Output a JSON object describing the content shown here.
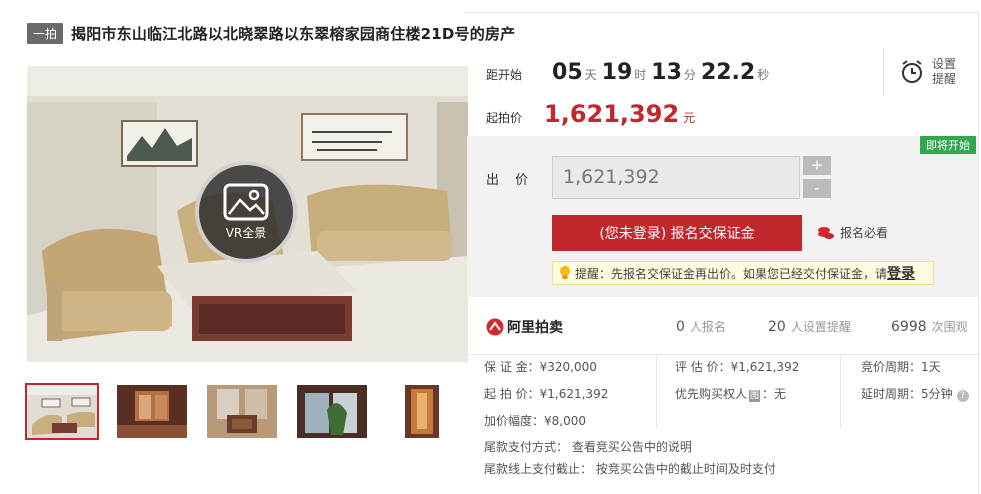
{
  "header": {
    "tag": "一拍",
    "title": "揭阳市东山临江北路以北晓翠路以东翠榕家园商住楼21D号的房产"
  },
  "countdown": {
    "label": "距开始",
    "days": "05",
    "days_unit": "天",
    "hours": "19",
    "hours_unit": "时",
    "minutes": "13",
    "minutes_unit": "分",
    "seconds": "22.2",
    "seconds_unit": "秒"
  },
  "reminder": {
    "label": "设置提醒",
    "icon": "alarm-clock-icon"
  },
  "start_price": {
    "label": "起拍价",
    "value": "1,621,392",
    "unit": "元"
  },
  "bid": {
    "badge": "即将开始",
    "label": "出 价",
    "value": "1,621,392",
    "plus": "+",
    "minus": "-",
    "register_button": "(您未登录) 报名交保证金",
    "must_read": "报名必看",
    "tip_text": "提醒：先报名交保证金再出价。如果您已经交付保证金，请",
    "tip_login": "登录"
  },
  "stats": {
    "brand": "阿里拍卖",
    "signups_count": "0",
    "signups_label": "人报名",
    "reminders_count": "20",
    "reminders_label": "人设置提醒",
    "views_count": "6998",
    "views_label": "次围观"
  },
  "details": {
    "deposit": "保 证 金：¥320,000",
    "start": "起 拍 价：¥1,621,392",
    "increment": "加价幅度：¥8,000",
    "appraisal": "评 估 价：¥1,621,392",
    "priority_label": "优先购买权人",
    "priority_badge": "图",
    "priority_value": "：无",
    "cycle": "竞价周期：1天",
    "delay": "延时周期：5分钟",
    "payment_method": "尾款支付方式：  查看竞买公告中的说明",
    "payment_deadline": "尾款线上支付截止：  按竞买公告中的截止时间及时支付"
  },
  "main_image": {
    "vr_label": "VR全景"
  },
  "colors": {
    "accent": "#c1272d",
    "badge_green": "#31a850"
  }
}
